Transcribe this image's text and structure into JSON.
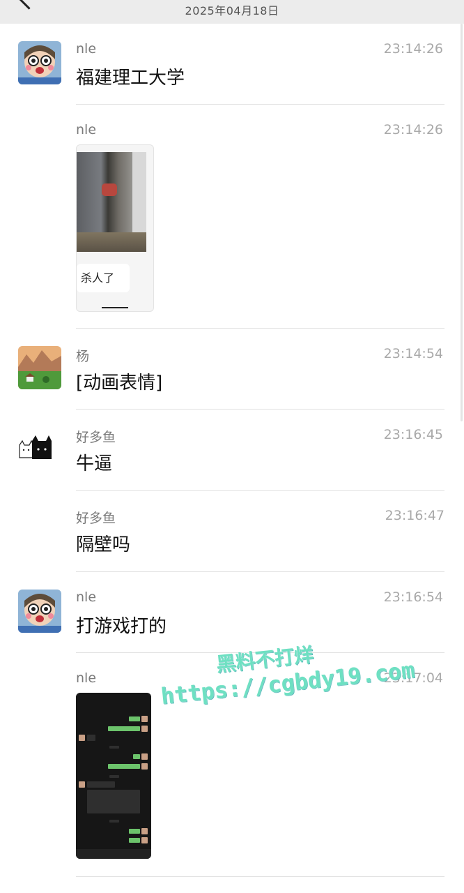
{
  "header": {
    "date": "2025年04月18日"
  },
  "messages": [
    {
      "name": "nle",
      "time": "23:14:26",
      "text": "福建理工大学",
      "avatar": "girl-avatar"
    },
    {
      "name": "nle",
      "time": "23:14:26",
      "image_caption": "杀人了",
      "avatar": "none"
    },
    {
      "name": "杨",
      "time": "23:14:54",
      "text": "[动画表情]",
      "avatar": "landscape-avatar"
    },
    {
      "name": "好多鱼",
      "time": "23:16:45",
      "text": "牛逼",
      "avatar": "cat-avatar"
    },
    {
      "name": "好多鱼",
      "time": "23:16:47",
      "text": "隔壁吗",
      "avatar": "none"
    },
    {
      "name": "nle",
      "time": "23:16:54",
      "text": "打游戏打的",
      "avatar": "girl-avatar"
    },
    {
      "name": "nle",
      "time": "23:17:04",
      "image": "chat-screenshot",
      "avatar": "none"
    }
  ],
  "watermark": {
    "line1": "黑料不打烊",
    "line2": "https://cgbdy19.com"
  }
}
